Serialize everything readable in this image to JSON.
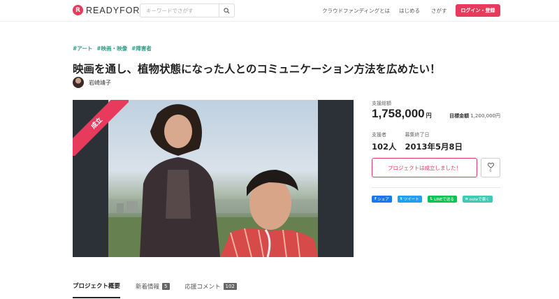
{
  "header": {
    "logo_mark": "R",
    "logo_text": "READYFOR",
    "search_placeholder": "キーワードでさがす",
    "nav": [
      "クラウドファンディングとは",
      "はじめる",
      "さがす"
    ],
    "login_label": "ログイン・登録"
  },
  "project": {
    "tags": [
      "#アート",
      "#映画・映像",
      "#障害者"
    ],
    "title": "映画を通し、植物状態になった人とのコミュニケーション方法を広めたい！",
    "author": "岩崎靖子",
    "badge": "成立"
  },
  "summary": {
    "total_label": "支援総額",
    "total_amount": "1,758,000",
    "currency": "円",
    "goal_label": "目標金額",
    "goal_amount": "1,200,000円",
    "supporters_label": "支援者",
    "supporters_value": "102人",
    "end_label": "募集終了日",
    "end_value": "2013年5月8日",
    "success_label": "プロジェクトは成立しました！",
    "favorite_count": "6"
  },
  "share": [
    {
      "label": "シェア",
      "icon": "f",
      "color": "#1877f2"
    },
    {
      "label": "ツイート",
      "icon": "t",
      "color": "#1da1f2"
    },
    {
      "label": "LINEで送る",
      "icon": "L",
      "color": "#06c755"
    },
    {
      "label": "noteで書く",
      "icon": "n",
      "color": "#41c9b4"
    }
  ],
  "tabs": [
    {
      "label": "プロジェクト概要",
      "count": ""
    },
    {
      "label": "新着情報",
      "count": "5"
    },
    {
      "label": "応援コメント",
      "count": "102"
    }
  ],
  "colors": {
    "accent": "#e83a5c",
    "tag": "#2d9b86"
  }
}
